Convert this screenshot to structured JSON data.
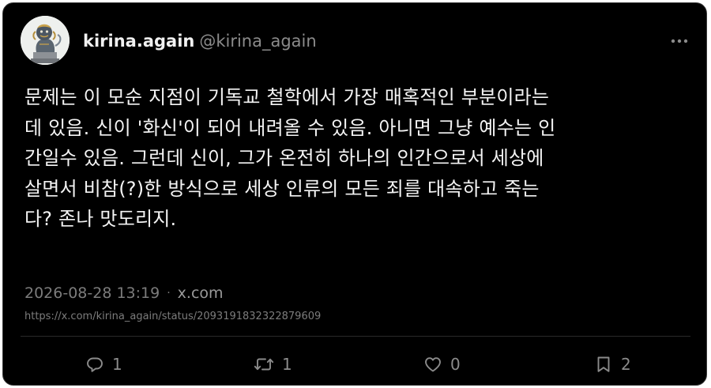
{
  "author": {
    "display_name": "kirina.again",
    "handle": "@kirina_again",
    "avatar_icon": "guardian-lion-statue-avatar"
  },
  "post": {
    "text": "문제는 이 모순 지점이 기독교 철학에서 가장 매혹적인 부분이라는\n데 있음. 신이 '화신'이 되어 내려올 수 있음. 아니면 그냥 예수는 인\n간일수 있음. 그런데 신이, 그가 온전히 하나의 인간으로서 세상에\n살면서 비참(?)한 방식으로 세상 인류의 모든 죄를 대속하고 죽는\n다? 존나 맛도리지.",
    "timestamp": "2026-08-28 13:19",
    "separator": "·",
    "source": "x.com",
    "url": "https://x.com/kirina_again/status/2093191832322879609"
  },
  "actions": {
    "reply_count": "1",
    "repost_count": "1",
    "like_count": "0",
    "bookmark_count": "2"
  },
  "icons": {
    "more": "more-horizontal-icon",
    "reply": "reply-icon",
    "repost": "repost-icon",
    "like": "heart-icon",
    "bookmark": "bookmark-icon"
  },
  "colors": {
    "background": "#000000",
    "text_primary": "#f4f4f4",
    "text_secondary": "#8b8b8b"
  }
}
